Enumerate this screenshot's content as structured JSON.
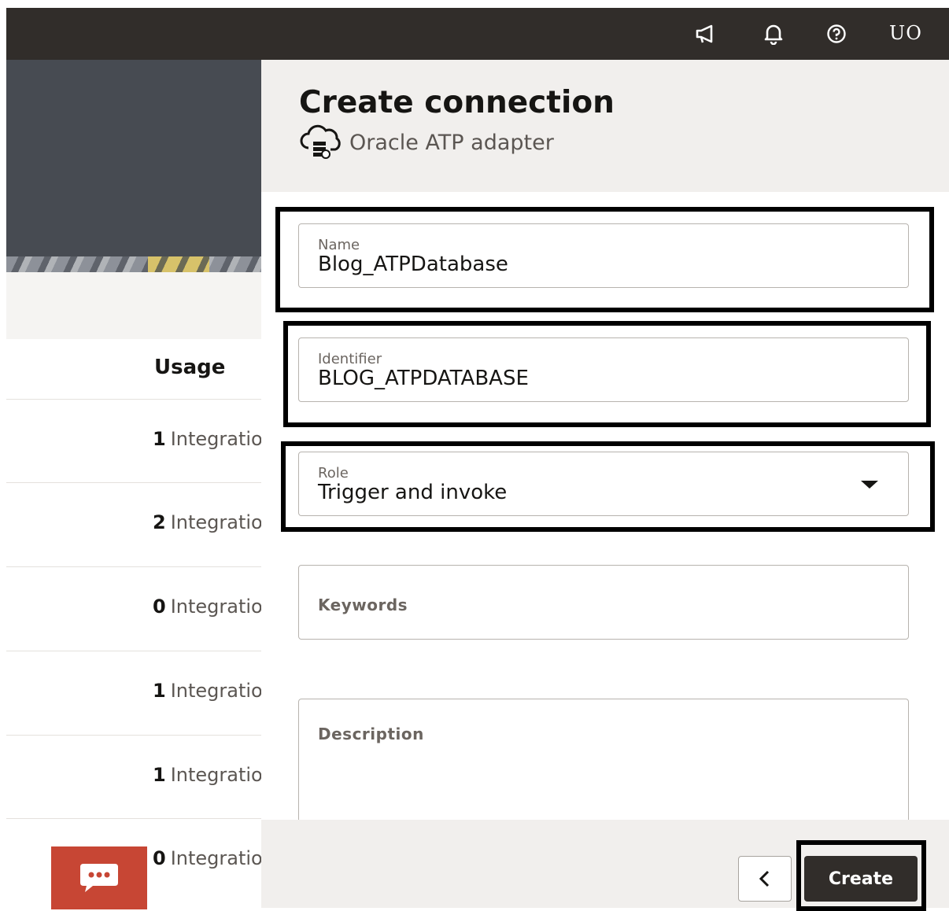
{
  "topbar": {
    "icons": [
      "announcement-icon",
      "notification-bell-icon",
      "help-icon"
    ],
    "user_initials": "UO",
    "background": "#312d2a"
  },
  "background_page": {
    "usage_header": "Usage",
    "rows": [
      {
        "count": "1",
        "label": "Integrations"
      },
      {
        "count": "2",
        "label": "Integrations"
      },
      {
        "count": "0",
        "label": "Integrations"
      },
      {
        "count": "1",
        "label": "Integrations"
      },
      {
        "count": "1",
        "label": "Integrations"
      },
      {
        "count": "0",
        "label": "Integrations"
      }
    ],
    "chat_icon": "chat-bubble-icon",
    "chat_color": "#c74634"
  },
  "drawer": {
    "title": "Create connection",
    "adapter_icon": "oracle-atp-cloud-icon",
    "adapter_name": "Oracle ATP adapter",
    "fields": {
      "name": {
        "label": "Name",
        "value": "Blog_ATPDatabase"
      },
      "identifier": {
        "label": "Identifier",
        "value": "BLOG_ATPDATABASE"
      },
      "role": {
        "label": "Role",
        "value": "Trigger and invoke"
      },
      "keywords": {
        "placeholder": "Keywords"
      },
      "description": {
        "placeholder": "Description"
      }
    },
    "footer": {
      "back_icon": "chevron-left-icon",
      "create_label": "Create"
    }
  }
}
